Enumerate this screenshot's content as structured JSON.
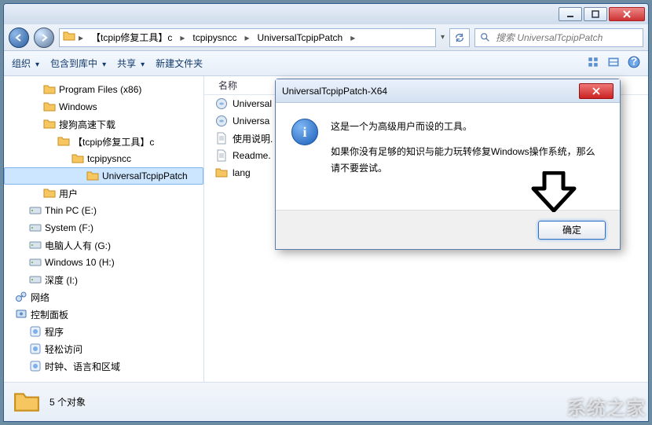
{
  "titlebar": {},
  "address": {
    "crumbs": [
      "【tcpip修复工具】c",
      "tcpipysncc",
      "UniversalTcpipPatch"
    ],
    "search_placeholder": "搜索 UniversalTcpipPatch"
  },
  "toolbar": {
    "organize": "组织",
    "include": "包含到库中",
    "share": "共享",
    "newfolder": "新建文件夹"
  },
  "tree": [
    {
      "indent": 2,
      "icon": "folder",
      "label": "Program Files (x86)"
    },
    {
      "indent": 2,
      "icon": "folder",
      "label": "Windows"
    },
    {
      "indent": 2,
      "icon": "folder",
      "label": "搜狗高速下载"
    },
    {
      "indent": 3,
      "icon": "folder",
      "label": "【tcpip修复工具】c"
    },
    {
      "indent": 4,
      "icon": "folder",
      "label": "tcpipysncc"
    },
    {
      "indent": 5,
      "icon": "folder",
      "label": "UniversalTcpipPatch",
      "selected": true
    },
    {
      "indent": 2,
      "icon": "folder",
      "label": "用户"
    },
    {
      "indent": 1,
      "icon": "drive",
      "label": "Thin PC (E:)"
    },
    {
      "indent": 1,
      "icon": "drive",
      "label": "System (F:)"
    },
    {
      "indent": 1,
      "icon": "drive",
      "label": "电脑人人有 (G:)"
    },
    {
      "indent": 1,
      "icon": "drive",
      "label": "Windows 10 (H:)"
    },
    {
      "indent": 1,
      "icon": "drive",
      "label": "深度 (I:)"
    },
    {
      "indent": 0,
      "icon": "net",
      "label": "网络"
    },
    {
      "indent": 0,
      "icon": "panel",
      "label": "控制面板"
    },
    {
      "indent": 1,
      "icon": "app",
      "label": "程序"
    },
    {
      "indent": 1,
      "icon": "app",
      "label": "轻松访问"
    },
    {
      "indent": 1,
      "icon": "app",
      "label": "时钟、语言和区域"
    }
  ],
  "files": {
    "column_header": "名称",
    "rows": [
      {
        "icon": "exe",
        "name": "Universal"
      },
      {
        "icon": "exe",
        "name": "Universa"
      },
      {
        "icon": "txt",
        "name": "使用说明."
      },
      {
        "icon": "txt",
        "name": "Readme."
      },
      {
        "icon": "folder",
        "name": "lang"
      }
    ]
  },
  "status": {
    "count_label": "5 个对象"
  },
  "dialog": {
    "title": "UniversalTcpipPatch-X64",
    "line1": "这是一个为高级用户而设的工具。",
    "line2": "如果你没有足够的知识与能力玩转修复Windows操作系统，那么请不要尝试。",
    "ok": "确定"
  },
  "watermark": "系统之家"
}
